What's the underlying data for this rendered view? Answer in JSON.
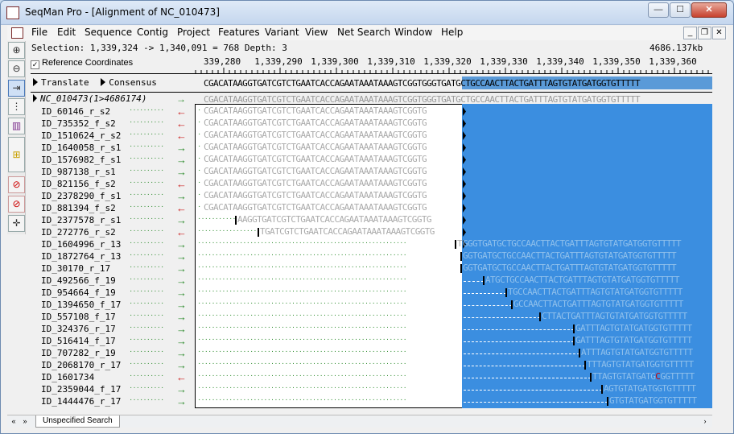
{
  "window": {
    "title": "SeqMan Pro - [Alignment of NC_010473]",
    "minimize": "—",
    "maximize": "☐",
    "close": "✕"
  },
  "menu": {
    "items": [
      "File",
      "Edit",
      "Sequence",
      "Contig",
      "Project",
      "Features",
      "Variant",
      "View",
      "Net Search",
      "Window",
      "Help"
    ],
    "mdi_min": "_",
    "mdi_restore": "❐",
    "mdi_close": "✕"
  },
  "status": {
    "selection": "Selection: 1,339,324 -> 1,340,091 = 768 Depth: 3",
    "length": "4686.137kb",
    "ref_coords_label": "Reference Coordinates"
  },
  "ruler": {
    "ticks": [
      "339,280",
      "1,339,290",
      "1,339,300",
      "1,339,310",
      "1,339,320",
      "1,339,330",
      "1,339,340",
      "1,339,350",
      "1,339,360"
    ]
  },
  "rows": {
    "translate": "Translate",
    "consensus": "Consensus",
    "consensus_seq": "CGACATAAGGTGATCGTCTGAATCACCAGAATAAATAAAGTCGGTGGGTGATGCTGCCAACTTACTGATTTAGTGTATGATGGTGTTTTT",
    "reference_name": "NC_010473(1>4686174)",
    "reference_seq": "CGACATAAGGTGATCGTCTGAATCACCAGAATAAATAAAGTCGGTGGGTGATGCTGCCAACTTACTGATTTAGTGTATGATGGTGTTTTT",
    "reference_arrow": "→"
  },
  "reads": [
    {
      "name": "ID_60146_r_s2",
      "arrow": "←",
      "color": "#cc2222",
      "seq": "CGACATAAGGTGATCGTCTGAATCACCAGAATAAATAAAGTCGGTG"
    },
    {
      "name": "ID_735352_f_s2",
      "arrow": "←",
      "color": "#cc2222",
      "seq": "CGACATAAGGTGATCGTCTGAATCACCAGAATAAATAAAGTCGGTG"
    },
    {
      "name": "ID_1510624_r_s2",
      "arrow": "←",
      "color": "#cc2222",
      "seq": "CGACATAAGGTGATCGTCTGAATCACCAGAATAAATAAAGTCGGTG"
    },
    {
      "name": "ID_1640058_r_s1",
      "arrow": "→",
      "color": "#2a8a2a",
      "seq": "CGACATAAGGTGATCGTCTGAATCACCAGAATAAATAAAGTCGGTG"
    },
    {
      "name": "ID_1576982_f_s1",
      "arrow": "→",
      "color": "#2a8a2a",
      "seq": "CGACATAAGGTGATCGTCTGAATCACCAGAATAAATAAAGTCGGTG"
    },
    {
      "name": "ID_987138_r_s1",
      "arrow": "→",
      "color": "#2a8a2a",
      "seq": "CGACATAAGGTGATCGTCTGAATCACCAGAATAAATAAAGTCGGTG"
    },
    {
      "name": "ID_821156_f_s2",
      "arrow": "←",
      "color": "#cc2222",
      "seq": "CGACATAAGGTGATCGTCTGAATCACCAGAATAAATAAAGTCGGTG"
    },
    {
      "name": "ID_2378290_f_s1",
      "arrow": "→",
      "color": "#2a8a2a",
      "seq": "CGACATAAGGTGATCGTCTGAATCACCAGAATAAATAAAGTCGGTG"
    },
    {
      "name": "ID_881394_f_s2",
      "arrow": "←",
      "color": "#cc2222",
      "seq": "CGACATAAGGTGATCGTCTGAATCACCAGAATAAATAAAGTCGGTG"
    },
    {
      "name": "ID_2377578_r_s1",
      "arrow": "→",
      "color": "#2a8a2a",
      "seq": "AAGGTGATCGTCTGAATCACCAGAATAAATAAAGTCGGTG",
      "offset": 6
    },
    {
      "name": "ID_272776_r_s2",
      "arrow": "←",
      "color": "#cc2222",
      "seq": "TGATCGTCTGAATCACCAGAATAAATAAAGTCGGTG",
      "offset": 10
    },
    {
      "name": "ID_1604996_r_13",
      "arrow": "→",
      "color": "#2a8a2a",
      "seq": "TGGGTGATGCTGCCAACTTACTGATTTAGTGTATGATGGTGTTTTT",
      "offset": 45
    },
    {
      "name": "ID_1872764_r_13",
      "arrow": "→",
      "color": "#2a8a2a",
      "seq": "GGTGATGCTGCCAACTTACTGATTTAGTGTATGATGGTGTTTTT",
      "offset": 46
    },
    {
      "name": "ID_30170_r_17",
      "arrow": "→",
      "color": "#2a8a2a",
      "seq": "GGTGATGCTGCCAACTTACTGATTTAGTGTATGATGGTGTTTTT",
      "offset": 46
    },
    {
      "name": "ID_492566_f_19",
      "arrow": "→",
      "color": "#2a8a2a",
      "seq": "ATGCTGCCAACTTACTGATTTAGTGTATGATGGTGTTTTT",
      "offset": 50
    },
    {
      "name": "ID_954664_f_19",
      "arrow": "→",
      "color": "#2a8a2a",
      "seq": "TGCCAACTTACTGATTTAGTGTATGATGGTGTTTTT",
      "offset": 54
    },
    {
      "name": "ID_1394650_f_17",
      "arrow": "→",
      "color": "#2a8a2a",
      "seq": "GCCAACTTACTGATTTAGTGTATGATGGTGTTTTT",
      "offset": 55
    },
    {
      "name": "ID_557108_f_17",
      "arrow": "→",
      "color": "#2a8a2a",
      "seq": "CTTACTGATTTAGTGTATGATGGTGTTTTT",
      "offset": 60
    },
    {
      "name": "ID_324376_r_17",
      "arrow": "→",
      "color": "#2a8a2a",
      "seq": "GATTTAGTGTATGATGGTGTTTTT",
      "offset": 66
    },
    {
      "name": "ID_516414_f_17",
      "arrow": "→",
      "color": "#2a8a2a",
      "seq": "GATTTAGTGTATGATGGTGTTTTT",
      "offset": 66
    },
    {
      "name": "ID_707282_r_19",
      "arrow": "→",
      "color": "#2a8a2a",
      "seq": "ATTTAGTGTATGATGGTGTTTTT",
      "offset": 67
    },
    {
      "name": "ID_2068170_r_17",
      "arrow": "→",
      "color": "#2a8a2a",
      "seq": "TTTAGTGTATGATGGTGTTTTT",
      "offset": 68
    },
    {
      "name": "ID_1601734",
      "arrow": "←",
      "color": "#cc2222",
      "seq": "TTAGTGTATGATGCGGTTTTT",
      "offset": 69
    },
    {
      "name": "ID_2359044_f_17",
      "arrow": "→",
      "color": "#2a8a2a",
      "seq": "AGTGTATGATGGTGTTTTT",
      "offset": 71
    },
    {
      "name": "ID_1444476_r_17",
      "arrow": "→",
      "color": "#2a8a2a",
      "seq": "GTGTATGATGGTGTTTTT",
      "offset": 72
    }
  ],
  "bottom": {
    "tab": "Unspecified Search",
    "left": "«",
    "right": "»",
    "arrow": "›"
  },
  "tools": [
    {
      "name": "zoom-in-icon",
      "glyph": "⊕"
    },
    {
      "name": "zoom-out-icon",
      "glyph": "⊖"
    },
    {
      "name": "navigate-icon",
      "glyph": "⇥"
    },
    {
      "name": "align-icon",
      "glyph": "⋮"
    },
    {
      "name": "columns-icon",
      "glyph": "▥"
    },
    {
      "name": "slider-icon",
      "glyph": "⊞"
    },
    {
      "name": "no-filter-icon",
      "glyph": "⊘"
    },
    {
      "name": "no-view-icon",
      "glyph": "⊘"
    },
    {
      "name": "crosshair-icon",
      "glyph": "✛"
    }
  ]
}
